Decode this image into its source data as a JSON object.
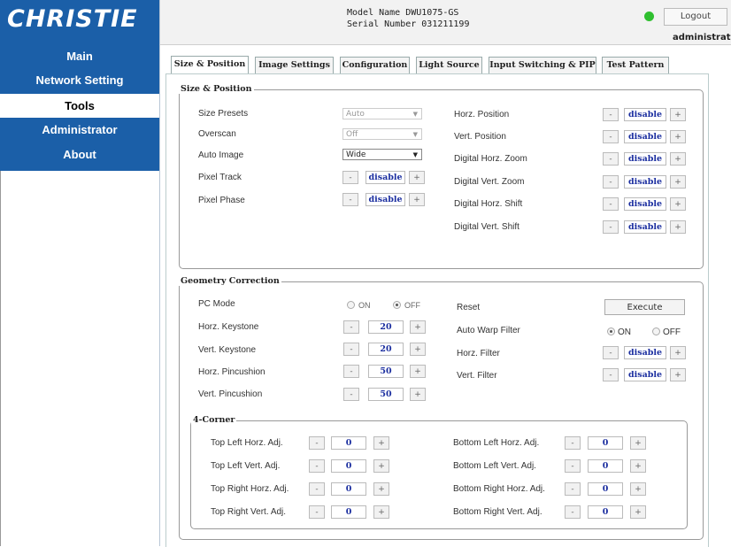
{
  "brand": {
    "logo_text": "CHRISTIE"
  },
  "header": {
    "model": "Model Name DWU1075-GS",
    "serial": "Serial Number 031211199",
    "logout": "Logout",
    "user": "administrato",
    "status_color": "#2fbf2f"
  },
  "nav": {
    "items": [
      {
        "label": "Main"
      },
      {
        "label": "Network Setting"
      },
      {
        "label": "Tools"
      },
      {
        "label": "Administrator"
      },
      {
        "label": "About"
      }
    ],
    "active": "Tools"
  },
  "tabs": [
    {
      "label": "Size & Position"
    },
    {
      "label": "Image Settings"
    },
    {
      "label": "Configuration"
    },
    {
      "label": "Light Source"
    },
    {
      "label": "Input Switching & PIP"
    },
    {
      "label": "Test Pattern"
    }
  ],
  "size_position": {
    "title": "Size & Position",
    "size_presets": {
      "label": "Size Presets",
      "value": "Auto"
    },
    "overscan": {
      "label": "Overscan",
      "value": "Off"
    },
    "auto_image": {
      "label": "Auto Image",
      "value": "Wide"
    },
    "pixel_track": {
      "label": "Pixel Track",
      "value": "disable"
    },
    "pixel_phase": {
      "label": "Pixel Phase",
      "value": "disable"
    },
    "right": [
      {
        "label": "Horz. Position",
        "value": "disable"
      },
      {
        "label": "Vert. Position",
        "value": "disable"
      },
      {
        "label": "Digital Horz. Zoom",
        "value": "disable"
      },
      {
        "label": "Digital Vert. Zoom",
        "value": "disable"
      },
      {
        "label": "Digital Horz. Shift",
        "value": "disable"
      },
      {
        "label": "Digital Vert. Shift",
        "value": "disable"
      }
    ]
  },
  "geometry": {
    "title": "Geometry Correction",
    "pc_mode": {
      "label": "PC Mode",
      "on": "ON",
      "off": "OFF"
    },
    "horz_keystone": {
      "label": "Horz. Keystone",
      "value": "20"
    },
    "vert_keystone": {
      "label": "Vert. Keystone",
      "value": "20"
    },
    "horz_pincushion": {
      "label": "Horz. Pincushion",
      "value": "50"
    },
    "vert_pincushion": {
      "label": "Vert. Pincushion",
      "value": "50"
    },
    "reset": {
      "label": "Reset",
      "button": "Execute"
    },
    "auto_warp": {
      "label": "Auto Warp Filter",
      "on": "ON",
      "off": "OFF"
    },
    "horz_filter": {
      "label": "Horz. Filter",
      "value": "disable"
    },
    "vert_filter": {
      "label": "Vert. Filter",
      "value": "disable"
    }
  },
  "corner": {
    "title": "4-Corner",
    "left": [
      {
        "label": "Top Left Horz. Adj.",
        "value": "0"
      },
      {
        "label": "Top Left Vert. Adj.",
        "value": "0"
      },
      {
        "label": "Top Right Horz. Adj.",
        "value": "0"
      },
      {
        "label": "Top Right Vert. Adj.",
        "value": "0"
      }
    ],
    "right": [
      {
        "label": "Bottom Left Horz. Adj.",
        "value": "0"
      },
      {
        "label": "Bottom Left Vert. Adj.",
        "value": "0"
      },
      {
        "label": "Bottom Right Horz. Adj.",
        "value": "0"
      },
      {
        "label": "Bottom Right Vert. Adj.",
        "value": "0"
      }
    ]
  },
  "controls": {
    "minus": "-",
    "plus": "+"
  }
}
